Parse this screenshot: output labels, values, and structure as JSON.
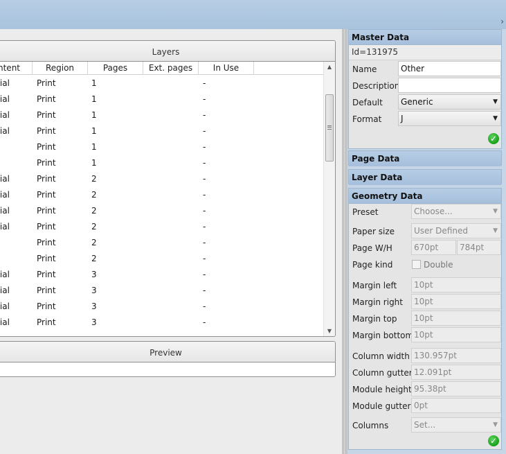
{
  "layers": {
    "title": "Layers",
    "columns": [
      "ntent",
      "Region",
      "Pages",
      "Ext. pages",
      "In Use"
    ],
    "rows": [
      [
        "rial",
        "Print",
        "1",
        "",
        "-"
      ],
      [
        "rial",
        "Print",
        "1",
        "",
        "-"
      ],
      [
        "rial",
        "Print",
        "1",
        "",
        "-"
      ],
      [
        "rial",
        "Print",
        "1",
        "",
        "-"
      ],
      [
        "",
        "Print",
        "1",
        "",
        "-"
      ],
      [
        "",
        "Print",
        "1",
        "",
        "-"
      ],
      [
        "rial",
        "Print",
        "2",
        "",
        "-"
      ],
      [
        "rial",
        "Print",
        "2",
        "",
        "-"
      ],
      [
        "rial",
        "Print",
        "2",
        "",
        "-"
      ],
      [
        "rial",
        "Print",
        "2",
        "",
        "-"
      ],
      [
        "",
        "Print",
        "2",
        "",
        "-"
      ],
      [
        "",
        "Print",
        "2",
        "",
        "-"
      ],
      [
        "rial",
        "Print",
        "3",
        "",
        "-"
      ],
      [
        "rial",
        "Print",
        "3",
        "",
        "-"
      ],
      [
        "rial",
        "Print",
        "3",
        "",
        "-"
      ],
      [
        "rial",
        "Print",
        "3",
        "",
        "-"
      ]
    ]
  },
  "preview": {
    "title": "Preview"
  },
  "master_data": {
    "title": "Master Data",
    "id_text": "Id=131975",
    "name_label": "Name",
    "name_value": "Other",
    "description_label": "Description",
    "description_value": "",
    "default_label": "Default",
    "default_value": "Generic",
    "format_label": "Format",
    "format_value": "J"
  },
  "page_data": {
    "title": "Page Data"
  },
  "layer_data": {
    "title": "Layer Data"
  },
  "geometry_data": {
    "title": "Geometry Data",
    "preset_label": "Preset",
    "preset_value": "Choose...",
    "paper_size_label": "Paper size",
    "paper_size_value": "User Defined",
    "page_wh_label": "Page W/H",
    "page_w_value": "670pt",
    "page_h_value": "784pt",
    "page_kind_label": "Page kind",
    "double_label": "Double",
    "margin_left_label": "Margin left",
    "margin_left_value": "10pt",
    "margin_right_label": "Margin right",
    "margin_right_value": "10pt",
    "margin_top_label": "Margin top",
    "margin_top_value": "10pt",
    "margin_bottom_label": "Margin bottom",
    "margin_bottom_value": "10pt",
    "column_width_label": "Column width",
    "column_width_value": "130.957pt",
    "column_gutter_label": "Column gutter",
    "column_gutter_value": "12.091pt",
    "module_height_label": "Module height",
    "module_height_value": "95.38pt",
    "module_gutter_label": "Module gutter",
    "module_gutter_value": "0pt",
    "columns_label": "Columns",
    "columns_value": "Set..."
  },
  "icons": {
    "collapse": "chevron-right-icon",
    "ok": "checkmark-icon",
    "dropdown": "triangle-down-icon"
  }
}
